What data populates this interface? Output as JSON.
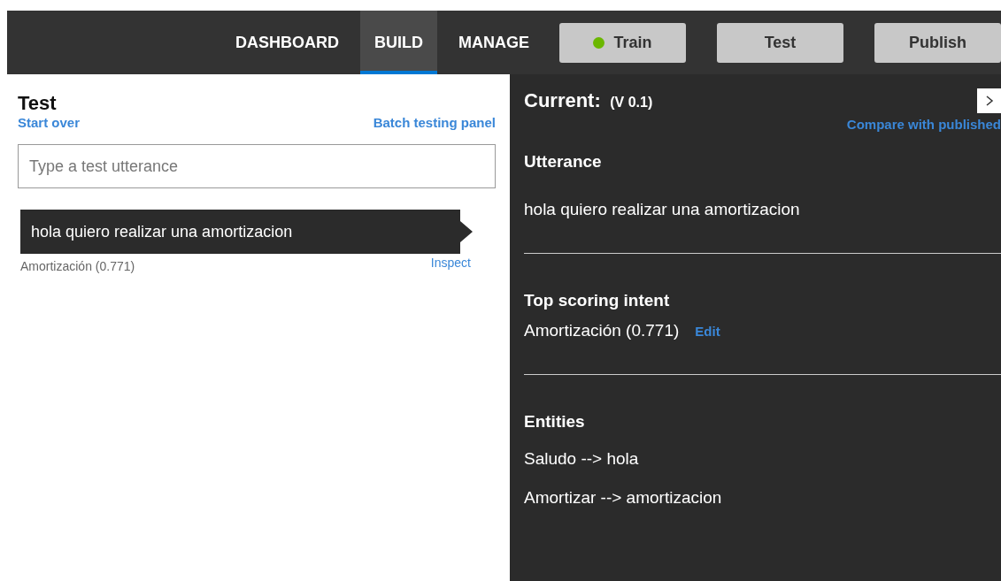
{
  "nav": {
    "tabs": [
      {
        "label": "DASHBOARD",
        "selected": false
      },
      {
        "label": "BUILD",
        "selected": true
      },
      {
        "label": "MANAGE",
        "selected": false
      }
    ],
    "buttons": [
      {
        "label": "Train",
        "color": "#6bb700"
      },
      {
        "label": "Test"
      },
      {
        "label": "Publish"
      }
    ]
  },
  "test_panel": {
    "title": "Test",
    "start_over": "Start over",
    "batch_link": "Batch testing panel",
    "input": {
      "placeholder": "Type a test utterance"
    },
    "results": [
      {
        "utterance": "hola quiero realizar una amortizacion",
        "intent": "Amortización (0.771)",
        "inspect": "Inspect",
        "selected": true
      }
    ]
  },
  "inspect_panel": {
    "title": "Current:",
    "version": "(V 0.1)",
    "compare_link": "Compare with published",
    "sections": [
      {
        "kind": "utterance",
        "heading": "Utterance",
        "text": "hola quiero realizar una amortizacion"
      },
      {
        "kind": "intent",
        "heading": "Top scoring intent",
        "text": "Amortización (0.771)",
        "link": "Edit"
      },
      {
        "kind": "entities",
        "heading": "Entities",
        "items": [
          "Saludo --> hola",
          "Amortizar --> amortizacion"
        ]
      }
    ]
  }
}
